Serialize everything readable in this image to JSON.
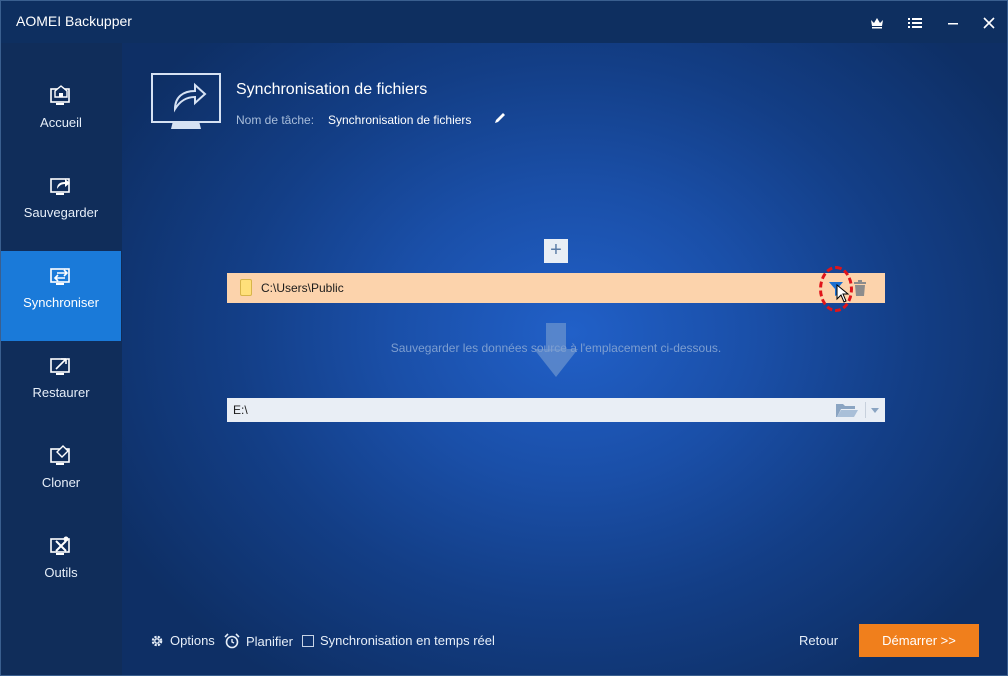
{
  "app": {
    "title": "AOMEI Backupper"
  },
  "titlebar_icons": [
    "crown-icon",
    "menu-icon",
    "minimize-icon",
    "close-icon"
  ],
  "sidebar": {
    "items": [
      {
        "label": "Accueil",
        "icon": "home-monitor-icon"
      },
      {
        "label": "Sauvegarder",
        "icon": "backup-monitor-icon"
      },
      {
        "label": "Synchroniser",
        "icon": "sync-monitor-icon",
        "active": true
      },
      {
        "label": "Restaurer",
        "icon": "restore-monitor-icon"
      },
      {
        "label": "Cloner",
        "icon": "clone-monitor-icon"
      },
      {
        "label": "Outils",
        "icon": "tools-monitor-icon"
      }
    ]
  },
  "header": {
    "title": "Synchronisation de fichiers",
    "task_name_label": "Nom de tâche:",
    "task_name_value": "Synchronisation de fichiers"
  },
  "source": {
    "path": "C:\\Users\\Public"
  },
  "hint": "Sauvegarder les données source à l'emplacement ci-dessous.",
  "destination": {
    "path": "E:\\"
  },
  "footer": {
    "options_label": "Options",
    "schedule_label": "Planifier",
    "realtime_label": "Synchronisation en temps réel",
    "realtime_checked": false,
    "back_label": "Retour",
    "start_label": "Démarrer >>"
  },
  "colors": {
    "sidebar_active": "#1a7ad9",
    "source_row": "#fcd3ac",
    "start_button": "#f07f1c",
    "highlight": "#e0141a"
  }
}
